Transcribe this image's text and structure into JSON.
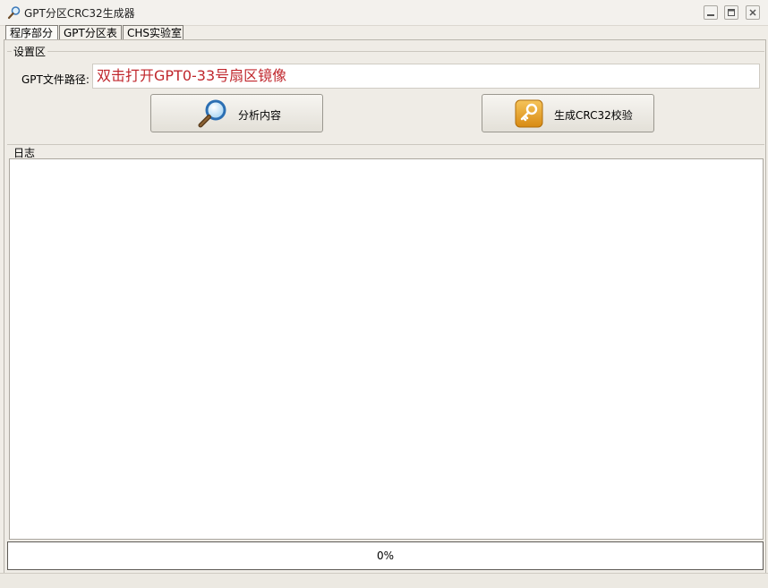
{
  "window": {
    "title": "GPT分区CRC32生成器",
    "icons": {
      "app": "magnifier-icon",
      "minimize": "minimize-icon",
      "maximize": "maximize-icon",
      "close": "close-icon"
    }
  },
  "tabs": [
    {
      "label": "程序部分",
      "active": true
    },
    {
      "label": "GPT分区表",
      "active": false
    },
    {
      "label": "CHS实验室",
      "active": false
    }
  ],
  "settings": {
    "group_label": "设置区",
    "path_label": "GPT文件路径:",
    "path_value": "双击打开GPT0-33号扇区镜像",
    "path_value_color": "#c0272d"
  },
  "buttons": {
    "analyze": {
      "label": "分析内容",
      "icon": "magnifier-icon"
    },
    "generate": {
      "label": "生成CRC32校验",
      "icon": "key-icon"
    }
  },
  "log": {
    "group_label": "日志",
    "content": ""
  },
  "progress": {
    "text": "0%",
    "value": 0
  }
}
